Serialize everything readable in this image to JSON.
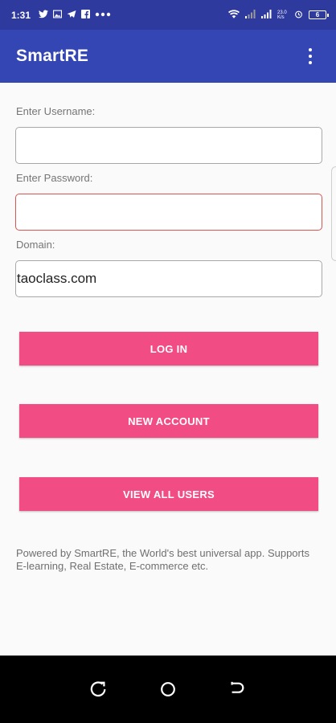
{
  "status_bar": {
    "time": "1:31",
    "notification_icons": [
      "twitter-icon",
      "gallery-icon",
      "telegram-icon",
      "facebook-icon",
      "more-dots-icon"
    ],
    "network_speed": "23.0 K/s",
    "battery_level": "6"
  },
  "app_bar": {
    "title": "SmartRE",
    "overflow_icon": "more-vert-icon"
  },
  "form": {
    "username_label": "Enter Username:",
    "username_value": "",
    "password_label": "Enter Password:",
    "password_value": "",
    "domain_label": "Domain:",
    "domain_value": "taoclass.com"
  },
  "buttons": {
    "login": "LOG IN",
    "new_account": "NEW ACCOUNT",
    "view_all_users": "VIEW ALL USERS"
  },
  "footer": {
    "text": "Powered by SmartRE, the World's best universal app. Supports E-learning, Real Estate, E-commerce etc."
  },
  "nav_bar": {
    "icons": [
      "recents-icon",
      "home-icon",
      "back-icon"
    ]
  },
  "colors": {
    "status_bar": "#2e3a9e",
    "app_bar": "#3446b4",
    "button": "#f14d84",
    "error_border": "#d9534f"
  }
}
